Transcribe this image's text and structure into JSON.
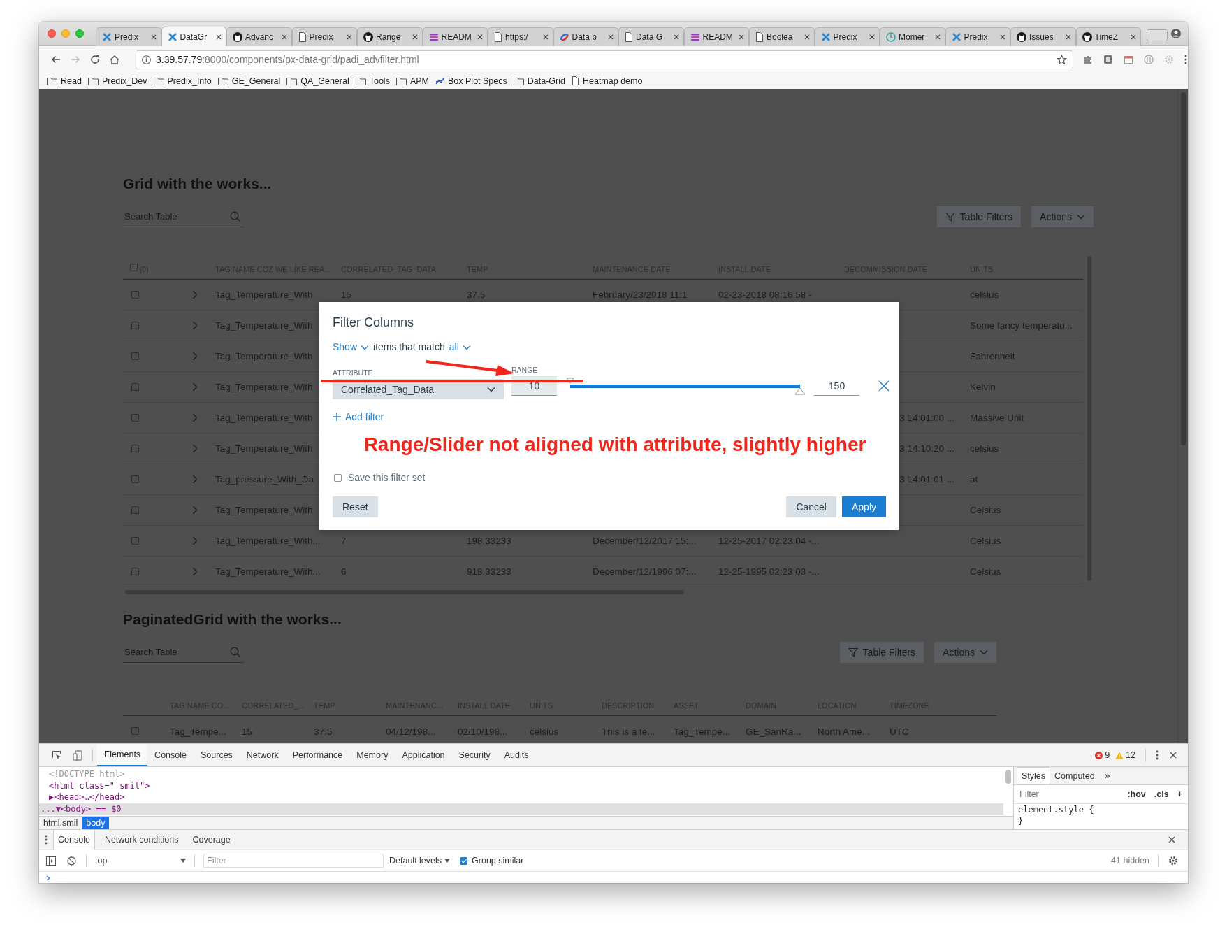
{
  "browser": {
    "tabs": [
      {
        "title": "Predix",
        "kind": "x-logo",
        "selected": false
      },
      {
        "title": "DataGr",
        "kind": "x-logo",
        "selected": true
      },
      {
        "title": "Advanc",
        "kind": "circle-logo",
        "selected": false
      },
      {
        "title": "Predix",
        "kind": "page",
        "selected": false
      },
      {
        "title": "Range",
        "kind": "circle-logo",
        "selected": false
      },
      {
        "title": "READM",
        "kind": "stack",
        "selected": false
      },
      {
        "title": "https:/",
        "kind": "page",
        "selected": false
      },
      {
        "title": "Data b",
        "kind": "swirl",
        "selected": false
      },
      {
        "title": "Data G",
        "kind": "page",
        "selected": false
      },
      {
        "title": "READM",
        "kind": "stack",
        "selected": false
      },
      {
        "title": "Boolea",
        "kind": "page",
        "selected": false
      },
      {
        "title": "Predix",
        "kind": "x-logo",
        "selected": false
      },
      {
        "title": "Momer",
        "kind": "clock",
        "selected": false
      },
      {
        "title": "Predix",
        "kind": "x-logo",
        "selected": false
      },
      {
        "title": "Issues",
        "kind": "circle-logo",
        "selected": false
      },
      {
        "title": "TimeZ",
        "kind": "circle-logo",
        "selected": false
      }
    ],
    "url": "**3.39.57.79**:8000/components/px-data-grid/padi_advfilter.html",
    "bookmarks": [
      {
        "label": "Read",
        "kind": "folder"
      },
      {
        "label": "Predix_Dev",
        "kind": "folder"
      },
      {
        "label": "Predix_Info",
        "kind": "folder"
      },
      {
        "label": "GE_General",
        "kind": "folder"
      },
      {
        "label": "QA_General",
        "kind": "folder"
      },
      {
        "label": "Tools",
        "kind": "folder"
      },
      {
        "label": "APM",
        "kind": "folder"
      },
      {
        "label": "Box Plot Specs",
        "kind": "chart"
      },
      {
        "label": "Data-Grid",
        "kind": "folder"
      },
      {
        "label": "Heatmap demo",
        "kind": "page"
      }
    ]
  },
  "grids": [
    {
      "title": "Grid with the works...",
      "search": {
        "placeholder": "Search Table"
      },
      "buttons": [
        {
          "label": "Table Filters",
          "kind": "filter"
        },
        {
          "label": "Actions",
          "kind": "menu"
        }
      ],
      "select_all": {
        "checked": false,
        "count": "(0)"
      },
      "columns": [
        "TAG NAME COZ WE LIKE REA...",
        "CORRELATED_TAG_DATA",
        "TEMP",
        "MAINTENANCE DATE",
        "INSTALL DATE",
        "DECOMMISSION DATE",
        "UNITS"
      ],
      "rows": [
        {
          "checked": false,
          "expandable": true,
          "cells": [
            "Tag_Temperature_With",
            "15",
            "37.5",
            "February/23/2018 11:1",
            "02-23-2018 08:16:58 -",
            null,
            "celsius"
          ]
        },
        {
          "checked": false,
          "expandable": true,
          "cells": [
            "Tag_Temperature_With",
            null,
            null,
            null,
            null,
            null,
            "Some fancy temperatu..."
          ]
        },
        {
          "checked": false,
          "expandable": true,
          "cells": [
            "Tag_Temperature_With",
            null,
            null,
            null,
            null,
            null,
            "Fahrenheit"
          ]
        },
        {
          "checked": false,
          "expandable": true,
          "cells": [
            "Tag_Temperature_With",
            null,
            null,
            null,
            null,
            null,
            "Kelvin"
          ]
        },
        {
          "checked": false,
          "expandable": true,
          "cells": [
            "Tag_Temperature_With",
            null,
            null,
            null,
            null,
            "3 14:01:00 ...",
            "Massive Unit"
          ]
        },
        {
          "checked": false,
          "expandable": true,
          "cells": [
            "Tag_Temperature_With",
            null,
            null,
            null,
            null,
            "3 14:10:20 ...",
            "celsius"
          ]
        },
        {
          "checked": false,
          "expandable": true,
          "cells": [
            "Tag_pressure_With_Da",
            null,
            null,
            null,
            null,
            "3 14:01:01 ...",
            "at"
          ]
        },
        {
          "checked": false,
          "expandable": true,
          "cells": [
            "Tag_Temperature_With",
            null,
            null,
            null,
            null,
            null,
            "Celsius"
          ]
        },
        {
          "checked": false,
          "expandable": true,
          "cells": [
            "Tag_Temperature_With...",
            "7",
            "198.33233",
            "December/12/2017 15:...",
            "12-25-2017 02:23:04 -...",
            null,
            "Celsius"
          ]
        },
        {
          "checked": false,
          "expandable": true,
          "cells": [
            "Tag_Temperature_With...",
            "6",
            "918.33233",
            "December/12/1996 07:...",
            "12-25-1995 02:23:03 -...",
            null,
            "Celsius"
          ]
        }
      ]
    },
    {
      "title": "PaginatedGrid with the works...",
      "search": {
        "placeholder": "Search Table"
      },
      "buttons": [
        {
          "label": "Table Filters",
          "kind": "filter"
        },
        {
          "label": "Actions",
          "kind": "menu"
        }
      ],
      "columns": [
        "TAG NAME CO...",
        "CORRELATED_...",
        "TEMP",
        "MAINTENANC...",
        "INSTALL DATE",
        "UNITS",
        "DESCRIPTION",
        "ASSET",
        "DOMAIN",
        "LOCATION",
        "TIMEZONE"
      ],
      "rows": [
        {
          "checked": false,
          "cells": [
            "Tag_Tempe...",
            "15",
            "37.5",
            "04/12/198...",
            "02/10/198...",
            "celsius",
            "This is a te...",
            "Tag_Tempe...",
            "GE_SanRa...",
            "North Ame...",
            "UTC"
          ]
        }
      ]
    }
  ],
  "modal": {
    "title": "Filter Columns",
    "match": {
      "show": "Show",
      "text": "items that match",
      "mode": "all"
    },
    "filters": [
      {
        "attribute_label": "ATTRIBUTE",
        "attribute": "Correlated_Tag_Data",
        "range_label": "RANGE",
        "min": "10",
        "max": "150",
        "level": 1
      }
    ],
    "add_filter": "Add filter",
    "note": "Range/Slider not aligned with attribute, slightly higher",
    "save": {
      "label": "Save this filter set",
      "checked": false
    },
    "buttons": [
      {
        "label": "Reset",
        "kind": "secondary"
      },
      {
        "label": "Cancel",
        "kind": "secondary"
      },
      {
        "label": "Apply",
        "kind": "primary"
      }
    ]
  },
  "devtools": {
    "tabs": [
      {
        "label": "Elements",
        "selected": true
      },
      {
        "label": "Console",
        "selected": false
      },
      {
        "label": "Sources",
        "selected": false
      },
      {
        "label": "Network",
        "selected": false
      },
      {
        "label": "Performance",
        "selected": false
      },
      {
        "label": "Memory",
        "selected": false
      },
      {
        "label": "Application",
        "selected": false
      },
      {
        "label": "Security",
        "selected": false
      },
      {
        "label": "Audits",
        "selected": false
      }
    ],
    "errors": "9",
    "warnings": "12",
    "dom_lines": [
      {
        "text": "<!DOCTYPE html>",
        "kind": "doctype",
        "selected": false
      },
      {
        "text": "<html class=\" smil\">",
        "kind": "tag",
        "selected": false
      },
      {
        "text": "▶<head>…</head>",
        "kind": "tag",
        "selected": false
      },
      {
        "text": "...▼<body> == $0",
        "kind": "tag",
        "selected": true
      }
    ],
    "breadcrumbs": [
      {
        "label": "html.smil",
        "selected": false
      },
      {
        "label": "body",
        "selected": true
      }
    ],
    "styles_tabs": [
      {
        "label": "Styles",
        "selected": true
      },
      {
        "label": "Computed",
        "selected": false
      }
    ],
    "styles_more": "»",
    "styles_filter": {
      "placeholder": "Filter"
    },
    "styles_toggles": [
      ":hov",
      ".cls",
      "+"
    ],
    "style_rule": [
      "element.style {",
      "}"
    ],
    "drawer_tabs": [
      {
        "label": "Console",
        "selected": true
      },
      {
        "label": "Network conditions",
        "selected": false
      },
      {
        "label": "Coverage",
        "selected": false
      }
    ],
    "console_toolbar": {
      "context": "top",
      "filter": {
        "placeholder": "Filter"
      },
      "levels": "Default levels",
      "group_similar": {
        "label": "Group similar",
        "checked": true
      },
      "hidden_count": "41 hidden"
    }
  }
}
